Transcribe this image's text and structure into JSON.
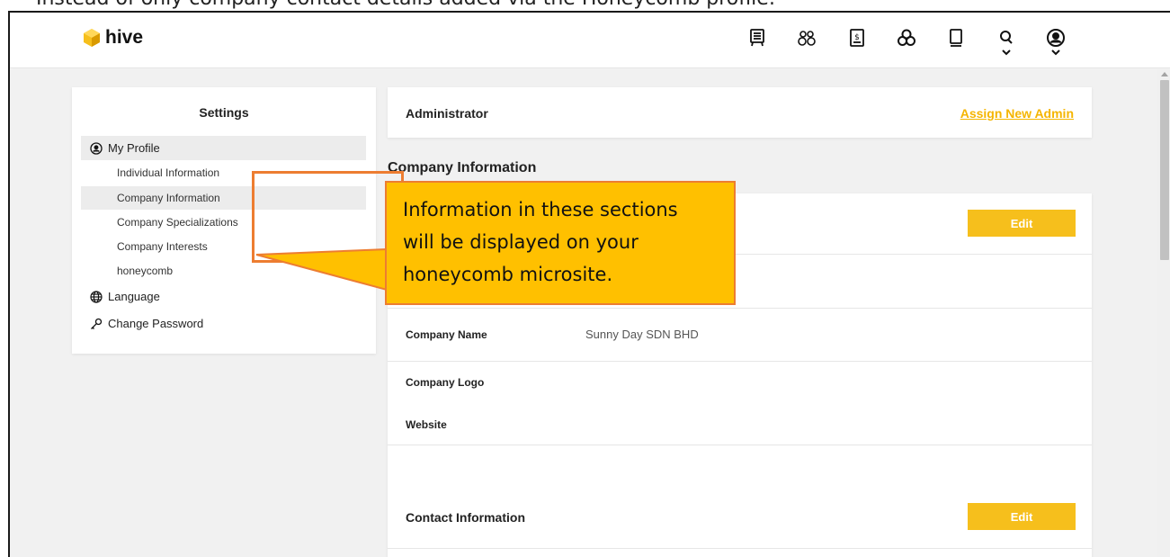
{
  "caption_top": "Instead of only company contact details added via the Honeycomb profile:",
  "header": {
    "logo_text": "hive",
    "icons": [
      {
        "name": "marketplace-icon"
      },
      {
        "name": "community-icon"
      },
      {
        "name": "finance-icon"
      },
      {
        "name": "honeycomb-icon"
      },
      {
        "name": "library-icon"
      },
      {
        "name": "search-icon"
      },
      {
        "name": "profile-icon"
      }
    ]
  },
  "sidebar": {
    "title": "Settings",
    "my_profile": "My Profile",
    "sub_items": [
      "Individual Information",
      "Company Information",
      "Company Specializations",
      "Company Interests",
      "honeycomb"
    ],
    "language": "Language",
    "change_password": "Change Password"
  },
  "admin": {
    "title": "Administrator",
    "assign_link": "Assign New Admin"
  },
  "company_info": {
    "heading": "Company Information",
    "edit_label": "Edit",
    "fields": {
      "company_name_label": "Company Name",
      "company_name_value": "Sunny Day SDN BHD",
      "company_logo_label": "Company Logo",
      "website_label": "Website"
    }
  },
  "contact_info": {
    "title": "Contact Information",
    "edit_label": "Edit"
  },
  "callout": {
    "lines": [
      "Information in these sections",
      "will be displayed on your",
      "honeycomb microsite."
    ]
  },
  "colors": {
    "accent": "#f6bf1c",
    "link": "#f5b500",
    "callout_fill": "#ffc000",
    "callout_border": "#ed7d31"
  }
}
